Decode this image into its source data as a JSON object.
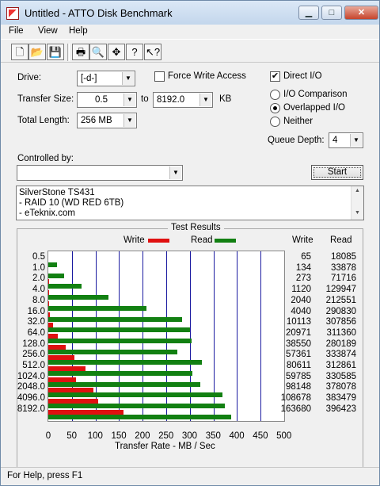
{
  "window": {
    "title": "Untitled - ATTO Disk Benchmark",
    "minimize": "▁",
    "maximize": "□",
    "close": "✕"
  },
  "menu": [
    "File",
    "View",
    "Help"
  ],
  "toolbar": {
    "icons": [
      "new-icon",
      "open-icon",
      "save-icon",
      "print-icon",
      "print-preview-icon",
      "move-icon",
      "help-icon",
      "context-help-icon"
    ],
    "glyphs": [
      "🗋",
      "📂",
      "💾",
      "🖶",
      "🔍",
      "✥",
      "?",
      "↖?"
    ]
  },
  "settings": {
    "drive_label": "Drive:",
    "drive_value": "[-d-]",
    "transfer_size_label": "Transfer Size:",
    "transfer_from": "0.5",
    "to_label": "to",
    "transfer_to": "8192.0",
    "unit": "KB",
    "total_length_label": "Total Length:",
    "total_length_value": "256 MB",
    "force_write_label": "Force Write Access",
    "force_write_checked": false,
    "direct_io_label": "Direct I/O",
    "direct_io_checked": true,
    "io_comparison_label": "I/O Comparison",
    "overlapped_io_label": "Overlapped I/O",
    "neither_label": "Neither",
    "selected_mode": "Overlapped I/O",
    "queue_depth_label": "Queue Depth:",
    "queue_depth_value": "4",
    "controlled_by_label": "Controlled by:",
    "controlled_by_value": "",
    "start_label": "Start"
  },
  "notes": [
    "SilverStone TS431",
    "- RAID 10 (WD RED 6TB)",
    "- eTeknix.com"
  ],
  "results": {
    "title": "Test Results",
    "write_legend": "Write",
    "read_legend": "Read",
    "write_header": "Write",
    "read_header": "Read",
    "xlabel": "Transfer Rate - MB / Sec"
  },
  "chart_data": {
    "type": "bar",
    "orientation": "horizontal",
    "categories": [
      "0.5",
      "1.0",
      "2.0",
      "4.0",
      "8.0",
      "16.0",
      "32.0",
      "64.0",
      "128.0",
      "256.0",
      "512.0",
      "1024.0",
      "2048.0",
      "4096.0",
      "8192.0"
    ],
    "series": [
      {
        "name": "Write",
        "color": "#e01010",
        "values": [
          65,
          134,
          273,
          1120,
          2040,
          4040,
          10113,
          20971,
          38550,
          57361,
          80611,
          59785,
          98148,
          108678,
          163680
        ]
      },
      {
        "name": "Read",
        "color": "#128012",
        "values": [
          18085,
          33878,
          71716,
          129947,
          212551,
          290830,
          307856,
          311360,
          280189,
          333874,
          312861,
          330585,
          378078,
          383479,
          396423
        ]
      }
    ],
    "xlabel": "Transfer Rate - MB / Sec",
    "xlim": [
      0,
      500
    ],
    "xticks": [
      "0",
      "50",
      "100",
      "150",
      "200",
      "250",
      "300",
      "350",
      "400",
      "450",
      "500"
    ],
    "grid": "vertical"
  },
  "status": "For Help, press F1"
}
